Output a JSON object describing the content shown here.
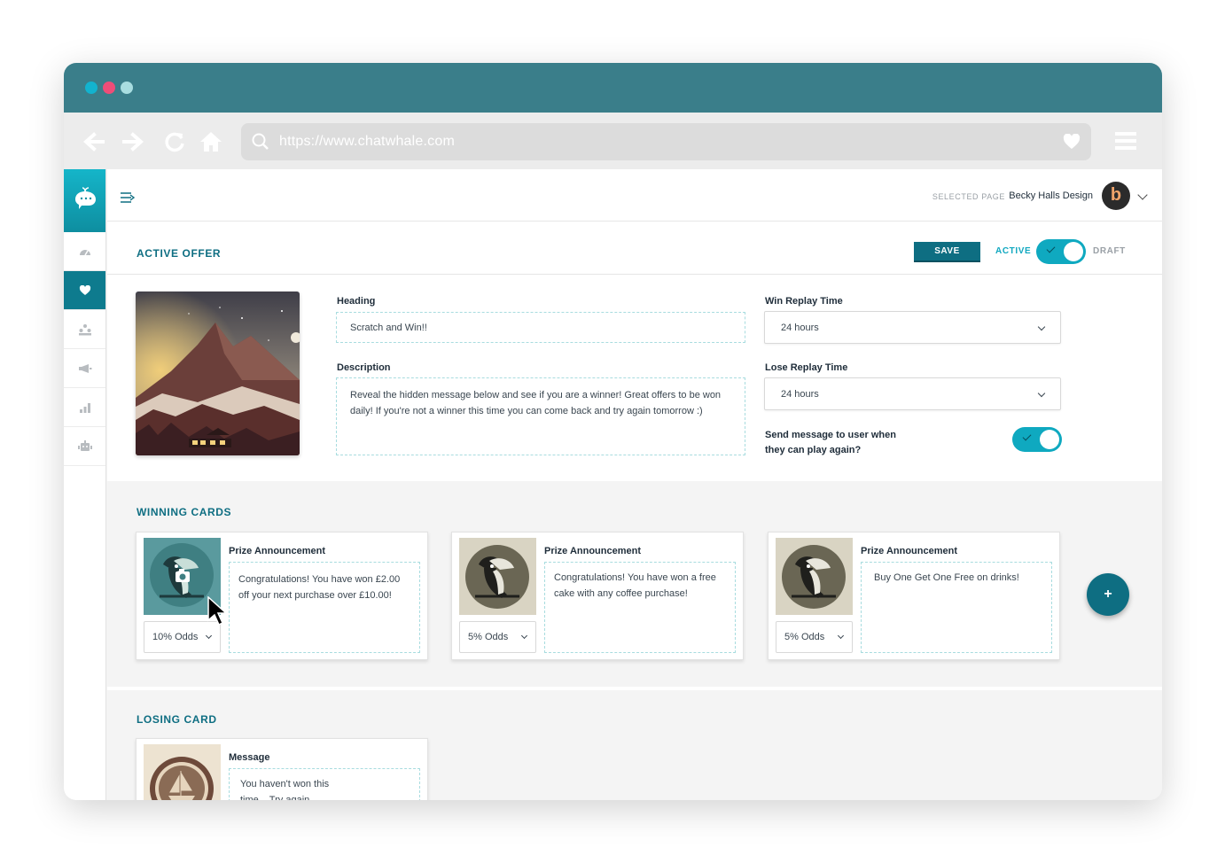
{
  "browser": {
    "url": "https://www.chatwhale.com",
    "dots": [
      "#12b3cf",
      "#ee4d78",
      "#a8dde0"
    ]
  },
  "header": {
    "selected_page_label": "SELECTED PAGE",
    "selected_page_name": "Becky Halls Design",
    "avatar_letter": "b"
  },
  "offer": {
    "title": "ACTIVE OFFER",
    "save_label": "SAVE",
    "active_label": "ACTIVE",
    "draft_label": "DRAFT",
    "heading_label": "Heading",
    "heading_value": "Scratch and Win!!",
    "description_label": "Description",
    "description_value": "Reveal the hidden message below and see if you are a winner! Great offers to be won daily! If you're not a winner this time you can come back and try again tomorrow :)",
    "win_replay_label": "Win Replay Time",
    "win_replay_value": "24 hours",
    "lose_replay_label": "Lose Replay Time",
    "lose_replay_value": "24 hours",
    "send_message_label": "Send message to user when they can play again?"
  },
  "winning": {
    "title": "WINNING CARDS",
    "cards": [
      {
        "title": "Prize Announcement",
        "text": "Congratulations! You have won £2.00 off your next purchase over £10.00!",
        "odds": "10% Odds"
      },
      {
        "title": "Prize Announcement",
        "text": "Congratulations! You have won a free cake with any coffee purchase!",
        "odds": "5% Odds"
      },
      {
        "title": "Prize Announcement",
        "text": "Buy One Get One Free on drinks!",
        "odds": "5% Odds"
      }
    ],
    "add_label": "+"
  },
  "losing": {
    "title": "LOSING CARD",
    "card_title": "Message",
    "text": "You haven't won this time... Try again tomorrow!"
  },
  "colors": {
    "brand": "#0e6e82",
    "titlebar": "#3a7e8a",
    "accent": "#0fa9c0"
  }
}
